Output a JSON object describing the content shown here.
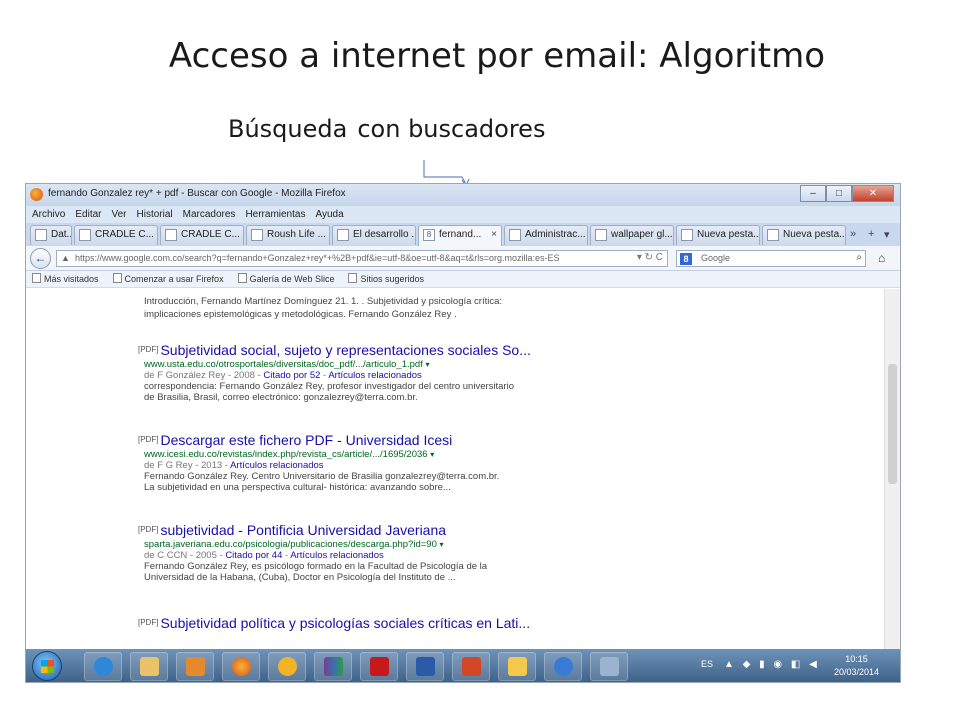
{
  "slide": {
    "title": "Acceso a internet por email: Algoritmo",
    "subtitle_part1": "Búsqueda",
    "subtitle_part2": "con buscadores"
  },
  "browser": {
    "window_title": "fernando Gonzalez rey* + pdf - Buscar con Google - Mozilla Firefox",
    "window_buttons": [
      "–",
      "□",
      "✕"
    ],
    "menu": [
      "Archivo",
      "Editar",
      "Ver",
      "Historial",
      "Marcadores",
      "Herramientas",
      "Ayuda"
    ],
    "tabs": [
      {
        "label": "Dat...",
        "icon": "page-icon"
      },
      {
        "label": "CRADLE  C...",
        "icon": "page-icon"
      },
      {
        "label": "CRADLE  C...",
        "icon": "page-icon"
      },
      {
        "label": "Roush Life ...",
        "icon": "globe-icon"
      },
      {
        "label": "El desarrollo ...",
        "icon": "puzzle-icon"
      },
      {
        "label": "fernand...",
        "icon": "google-icon",
        "active": true
      },
      {
        "label": "Administrac...",
        "icon": "admin-icon"
      },
      {
        "label": "wallpaper gl...",
        "icon": "cp-icon"
      },
      {
        "label": "Nueva pesta...",
        "icon": "page-icon"
      },
      {
        "label": "Nueva pesta...",
        "icon": "page-icon"
      }
    ],
    "tab_close": "×",
    "tab_scroll": "»",
    "tab_new": "+",
    "tab_list": "▾",
    "back_label": "←",
    "url": "https://www.google.com.co/search?q=fernando+Gonzalez+rey*+%2B+pdf&ie=utf-8&oe=utf-8&aq=t&rls=org.mozilla:es-ES",
    "url_controls": "▾ ↻ C",
    "search_engine": "Google",
    "search_engine_letter": "8",
    "search_icon": "⌕",
    "home_icon": "⌂",
    "bookmarks": [
      "Más visitados",
      "Comenzar a usar Firefox",
      "Galería de Web Slice",
      "Sitios sugeridos"
    ]
  },
  "results_page": {
    "top_snippet_1": "Introducción, Fernando Martínez Domínguez 21. 1. . Subjetividad y psicología crítica:",
    "top_snippet_2": "implicaciones epistemológicas y metodológicas. Fernando González Rey .",
    "results": [
      {
        "tag": "[PDF]",
        "title": "Subjetividad social, sujeto y representaciones sociales So...",
        "url": "www.usta.edu.co/otrosportales/diversitas/doc_pdf/.../articulo_1.pdf",
        "meta_1": "de F González Rey - 2008 - ",
        "cited": "Citado por 52",
        "related": "Artículos relacionados",
        "desc_1": "correspondencia: Fernando González Rey, profesor investigador del centro universitario",
        "desc_2": "de Brasilia, Brasil, correo electrónico: gonzalezrey@terra.com.br."
      },
      {
        "tag": "[PDF]",
        "title": "Descargar este fichero PDF - Universidad Icesi",
        "url": "www.icesi.edu.co/revistas/index.php/revista_cs/article/.../1695/2036",
        "meta_1": "de F G Rey - 2013 - ",
        "cited": "",
        "related": "Artículos relacionados",
        "desc_1": "Fernando González Rey. Centro Universitario de Brasilia gonzalezrey@terra.com.br.",
        "desc_2": "La subjetividad en una perspectiva cultural- histórica: avanzando sobre..."
      },
      {
        "tag": "[PDF]",
        "title": "subjetividad - Pontificia Universidad Javeriana",
        "url": "sparta.javeriana.edu.co/psicologia/publicaciones/descarga.php?id=90",
        "meta_1": "de C CCN - 2005 - ",
        "cited": "Citado por 44",
        "related": "Artículos relacionados",
        "desc_1": "Fernando González Rey, es psicólogo formado en la Facultad de Psicología de la",
        "desc_2": "Universidad de la Habana, (Cuba), Doctor en Psicología del Instituto de ..."
      },
      {
        "tag": "[PDF]",
        "title": "Subjetividad política y psicologías sociales críticas en Lati...",
        "url": "",
        "meta_1": "",
        "cited": "",
        "related": "",
        "desc_1": "",
        "desc_2": ""
      }
    ]
  },
  "taskbar": {
    "apps": [
      "internet-explorer",
      "file-explorer",
      "media-player",
      "firefox",
      "app-gallery",
      "winrar",
      "acrobat-reader",
      "word",
      "powerpoint",
      "outlook",
      "network-globe",
      "tools"
    ],
    "tray_language": "ES",
    "tray_symbols": "▲ ◆ ▮ ◉ ◧ ◀",
    "clock_time": "10:15",
    "clock_date": "20/03/2014",
    "colors": {
      "taskbar": "#4a6f98",
      "link": "#1a0dab",
      "url_green": "#006621"
    }
  }
}
